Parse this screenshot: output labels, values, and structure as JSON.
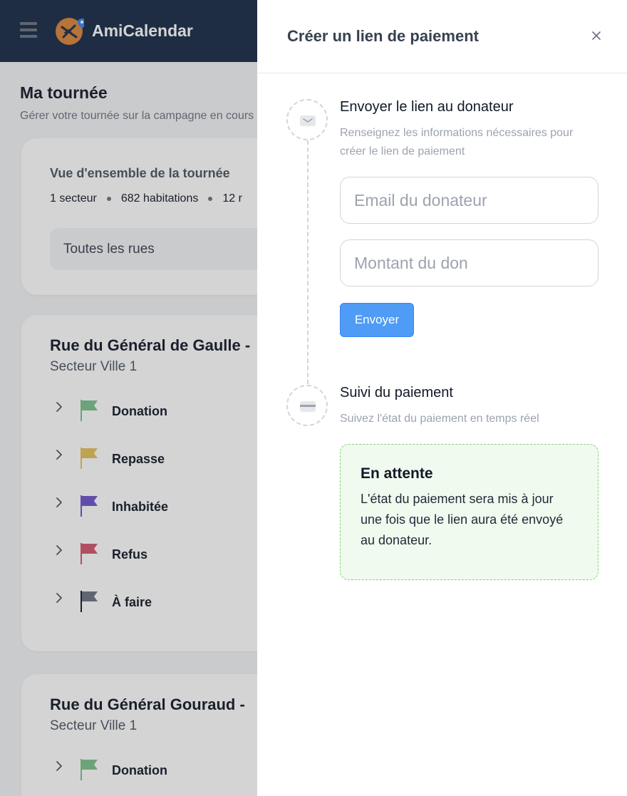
{
  "app": {
    "name": "AmiCalendar"
  },
  "page": {
    "title": "Ma tournée",
    "subtitle": "Gérer votre tournée sur la campagne en cours"
  },
  "overview": {
    "title": "Vue d'ensemble de la tournée",
    "stat_sectors": "1 secteur",
    "stat_homes": "682 habitations",
    "stat_more": "12 r",
    "street_filter": "Toutes les rues"
  },
  "streets": [
    {
      "name": "Rue du Général de Gaulle - ",
      "sector": "Secteur Ville 1",
      "statuses": [
        {
          "label": "Donation",
          "color": "#7cc08a"
        },
        {
          "label": "Repasse",
          "color": "#e5c15a"
        },
        {
          "label": "Inhabitée",
          "color": "#6d54c9"
        },
        {
          "label": "Refus",
          "color": "#d0566e"
        },
        {
          "label": "À faire",
          "color": "#6b7280"
        }
      ]
    },
    {
      "name": "Rue du Général Gouraud - ",
      "sector": "Secteur Ville 1",
      "statuses": [
        {
          "label": "Donation",
          "color": "#7cc08a"
        }
      ]
    }
  ],
  "panel": {
    "title": "Créer un lien de paiement",
    "step1": {
      "title": "Envoyer le lien au donateur",
      "description": "Renseignez les informations nécessaires pour créer le lien de paiement",
      "email_placeholder": "Email du donateur",
      "amount_placeholder": "Montant du don",
      "submit_label": "Envoyer"
    },
    "step2": {
      "title": "Suivi du paiement",
      "description": "Suivez l'état du paiement en temps réel",
      "status_title": "En attente",
      "status_text": "L'état du paiement sera mis à jour une fois que le lien aura été envoyé au donateur."
    }
  },
  "colors": {
    "topbar": "#172a46",
    "accent": "#4f9cf6",
    "pending_border": "#86d27a",
    "pending_bg": "#f0faee",
    "logo": "#d9833a"
  }
}
